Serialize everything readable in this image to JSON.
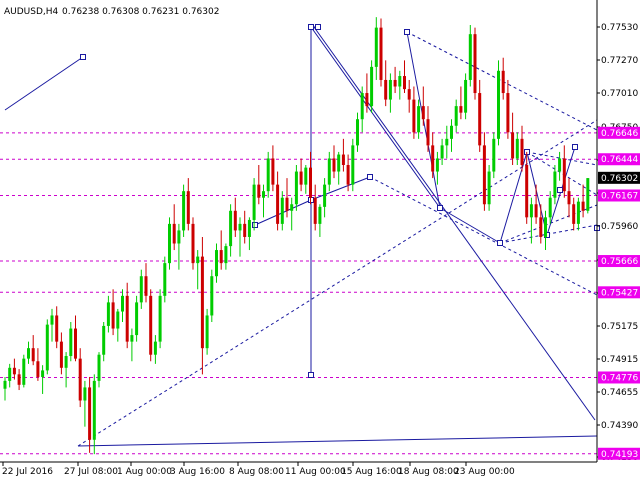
{
  "header": {
    "symbol": "AUDUSD,H4",
    "quotes": "0.76238 0.76308 0.76231 0.76302"
  },
  "colors": {
    "background": "#ffffff",
    "frame": "#000000",
    "bull_candle": "#00cc00",
    "bear_candle": "#cc0000",
    "level_line": "#cc00cc",
    "level_label_bg": "#ee00ee",
    "current_price_bg": "#000000",
    "trendline": "#1a1aa0",
    "channel_dotted": "#1a1aa0",
    "pattern_line": "#1a1aa0"
  },
  "icons": {
    "anchor_marker": "square-anchor-icon"
  },
  "chart_data": {
    "type": "candlestick",
    "timeframe": "H4",
    "y_axis": {
      "ylim": [
        0.7413,
        0.776
      ],
      "ticks": [
        "0.77530",
        "0.77270",
        "0.77010",
        "0.76750",
        "0.76490",
        "0.76225",
        "0.75960",
        "0.75700",
        "0.75435",
        "0.75175",
        "0.74915",
        "0.74655",
        "0.74390",
        "0.74130"
      ]
    },
    "x_axis": {
      "labels": [
        "22 Jul 2016",
        "27 Jul 08:00",
        "1 Aug 00:00",
        "3 Aug 16:00",
        "8 Aug 08:00",
        "11 Aug 00:00",
        "15 Aug 16:00",
        "18 Aug 08:00",
        "23 Aug 00:00"
      ]
    },
    "current_price": "0.76302",
    "levels": [
      {
        "value": 0.76646,
        "label": "0.76646"
      },
      {
        "value": 0.76444,
        "label": "0.76444"
      },
      {
        "value": 0.76167,
        "label": "0.76167"
      },
      {
        "value": 0.75666,
        "label": "0.75666"
      },
      {
        "value": 0.75427,
        "label": "0.75427"
      },
      {
        "value": 0.74776,
        "label": "0.74776"
      },
      {
        "value": 0.74193,
        "label": "0.74193"
      }
    ],
    "candles": [
      [
        0.7469,
        0.7478,
        0.746,
        0.7475
      ],
      [
        0.7475,
        0.7488,
        0.747,
        0.7485
      ],
      [
        0.7485,
        0.7492,
        0.7476,
        0.748
      ],
      [
        0.748,
        0.7484,
        0.7468,
        0.7472
      ],
      [
        0.7472,
        0.7495,
        0.747,
        0.7492
      ],
      [
        0.7492,
        0.7505,
        0.7488,
        0.75
      ],
      [
        0.75,
        0.751,
        0.7487,
        0.749
      ],
      [
        0.749,
        0.75,
        0.7475,
        0.7478
      ],
      [
        0.7478,
        0.7487,
        0.7465,
        0.7483
      ],
      [
        0.7483,
        0.7522,
        0.748,
        0.7518
      ],
      [
        0.7518,
        0.753,
        0.7505,
        0.7525
      ],
      [
        0.7525,
        0.7532,
        0.75,
        0.7505
      ],
      [
        0.7505,
        0.7512,
        0.748,
        0.7485
      ],
      [
        0.7485,
        0.7497,
        0.747,
        0.7494
      ],
      [
        0.7494,
        0.752,
        0.749,
        0.7515
      ],
      [
        0.7515,
        0.7525,
        0.749,
        0.7492
      ],
      [
        0.7492,
        0.75,
        0.7455,
        0.746
      ],
      [
        0.746,
        0.7475,
        0.744,
        0.747
      ],
      [
        0.747,
        0.7478,
        0.742,
        0.743
      ],
      [
        0.743,
        0.748,
        0.7419,
        0.7475
      ],
      [
        0.7475,
        0.7497,
        0.747,
        0.7495
      ],
      [
        0.7495,
        0.752,
        0.749,
        0.7517
      ],
      [
        0.7517,
        0.754,
        0.7512,
        0.7535
      ],
      [
        0.7535,
        0.7545,
        0.751,
        0.7515
      ],
      [
        0.7515,
        0.753,
        0.7505,
        0.7528
      ],
      [
        0.7528,
        0.7545,
        0.752,
        0.754
      ],
      [
        0.754,
        0.755,
        0.75,
        0.7505
      ],
      [
        0.7505,
        0.7515,
        0.749,
        0.751
      ],
      [
        0.751,
        0.754,
        0.7505,
        0.7535
      ],
      [
        0.7535,
        0.756,
        0.753,
        0.7555
      ],
      [
        0.7555,
        0.7565,
        0.7535,
        0.754
      ],
      [
        0.754,
        0.7545,
        0.749,
        0.7495
      ],
      [
        0.7495,
        0.751,
        0.7488,
        0.7505
      ],
      [
        0.7505,
        0.7545,
        0.75,
        0.754
      ],
      [
        0.754,
        0.757,
        0.7535,
        0.7565
      ],
      [
        0.7565,
        0.76,
        0.756,
        0.7595
      ],
      [
        0.7595,
        0.761,
        0.7575,
        0.758
      ],
      [
        0.758,
        0.7595,
        0.756,
        0.759
      ],
      [
        0.759,
        0.7625,
        0.7585,
        0.762
      ],
      [
        0.762,
        0.763,
        0.759,
        0.7595
      ],
      [
        0.7595,
        0.76,
        0.756,
        0.7565
      ],
      [
        0.7565,
        0.7575,
        0.7545,
        0.757
      ],
      [
        0.757,
        0.7585,
        0.748,
        0.75
      ],
      [
        0.75,
        0.753,
        0.7495,
        0.7525
      ],
      [
        0.7525,
        0.756,
        0.752,
        0.7555
      ],
      [
        0.7555,
        0.758,
        0.755,
        0.7575
      ],
      [
        0.7575,
        0.759,
        0.756,
        0.7565
      ],
      [
        0.7565,
        0.758,
        0.756,
        0.7578
      ],
      [
        0.7578,
        0.761,
        0.757,
        0.7605
      ],
      [
        0.7605,
        0.7615,
        0.7585,
        0.759
      ],
      [
        0.759,
        0.76,
        0.757,
        0.7595
      ],
      [
        0.7595,
        0.7605,
        0.758,
        0.7585
      ],
      [
        0.7585,
        0.76,
        0.7575,
        0.7598
      ],
      [
        0.7598,
        0.763,
        0.759,
        0.7625
      ],
      [
        0.7625,
        0.764,
        0.761,
        0.7615
      ],
      [
        0.7615,
        0.7625,
        0.76,
        0.762
      ],
      [
        0.762,
        0.765,
        0.7615,
        0.7645
      ],
      [
        0.7645,
        0.7655,
        0.762,
        0.7625
      ],
      [
        0.7625,
        0.7635,
        0.759,
        0.7595
      ],
      [
        0.7595,
        0.762,
        0.759,
        0.7615
      ],
      [
        0.7615,
        0.763,
        0.76,
        0.7605
      ],
      [
        0.7605,
        0.7615,
        0.759,
        0.761
      ],
      [
        0.761,
        0.764,
        0.7605,
        0.7635
      ],
      [
        0.7635,
        0.7645,
        0.762,
        0.7625
      ],
      [
        0.7625,
        0.764,
        0.7618,
        0.7638
      ],
      [
        0.7638,
        0.765,
        0.761,
        0.7615
      ],
      [
        0.7615,
        0.7625,
        0.759,
        0.7595
      ],
      [
        0.7595,
        0.761,
        0.7585,
        0.7608
      ],
      [
        0.7608,
        0.763,
        0.76,
        0.7625
      ],
      [
        0.7625,
        0.765,
        0.762,
        0.7645
      ],
      [
        0.7645,
        0.7655,
        0.763,
        0.7635
      ],
      [
        0.7635,
        0.765,
        0.7625,
        0.7648
      ],
      [
        0.7648,
        0.766,
        0.7635,
        0.764
      ],
      [
        0.764,
        0.7648,
        0.762,
        0.7625
      ],
      [
        0.7625,
        0.766,
        0.762,
        0.7655
      ],
      [
        0.7655,
        0.768,
        0.765,
        0.7675
      ],
      [
        0.7675,
        0.77,
        0.7665,
        0.7695
      ],
      [
        0.7695,
        0.771,
        0.768,
        0.7685
      ],
      [
        0.7685,
        0.772,
        0.768,
        0.7715
      ],
      [
        0.7715,
        0.7753,
        0.7705,
        0.7745
      ],
      [
        0.7745,
        0.7752,
        0.77,
        0.7705
      ],
      [
        0.7705,
        0.772,
        0.7685,
        0.769
      ],
      [
        0.769,
        0.771,
        0.768,
        0.7705
      ],
      [
        0.7705,
        0.7715,
        0.7695,
        0.77
      ],
      [
        0.77,
        0.7712,
        0.769,
        0.7708
      ],
      [
        0.7708,
        0.772,
        0.7695,
        0.7698
      ],
      [
        0.7698,
        0.7705,
        0.768,
        0.769
      ],
      [
        0.769,
        0.77,
        0.766,
        0.7665
      ],
      [
        0.7665,
        0.769,
        0.766,
        0.7685
      ],
      [
        0.7685,
        0.77,
        0.767,
        0.7675
      ],
      [
        0.7675,
        0.7685,
        0.765,
        0.7655
      ],
      [
        0.7655,
        0.7665,
        0.763,
        0.7635
      ],
      [
        0.7635,
        0.765,
        0.7625,
        0.7645
      ],
      [
        0.7645,
        0.766,
        0.764,
        0.7655
      ],
      [
        0.7655,
        0.767,
        0.7645,
        0.766
      ],
      [
        0.766,
        0.7675,
        0.765,
        0.767
      ],
      [
        0.767,
        0.769,
        0.7665,
        0.7685
      ],
      [
        0.7685,
        0.77,
        0.7675,
        0.768
      ],
      [
        0.768,
        0.771,
        0.7675,
        0.7705
      ],
      [
        0.7705,
        0.7747,
        0.77,
        0.774
      ],
      [
        0.774,
        0.7745,
        0.769,
        0.7695
      ],
      [
        0.7695,
        0.7705,
        0.765,
        0.7655
      ],
      [
        0.7655,
        0.7665,
        0.7605,
        0.761
      ],
      [
        0.761,
        0.764,
        0.7605,
        0.7635
      ],
      [
        0.7635,
        0.7665,
        0.763,
        0.766
      ],
      [
        0.766,
        0.772,
        0.7655,
        0.7712
      ],
      [
        0.7712,
        0.7722,
        0.769,
        0.7695
      ],
      [
        0.7695,
        0.7705,
        0.766,
        0.7665
      ],
      [
        0.7665,
        0.768,
        0.764,
        0.7645
      ],
      [
        0.7645,
        0.7665,
        0.764,
        0.766
      ],
      [
        0.766,
        0.767,
        0.7635,
        0.764
      ],
      [
        0.764,
        0.765,
        0.7595,
        0.76
      ],
      [
        0.76,
        0.7615,
        0.758,
        0.761
      ],
      [
        0.761,
        0.7625,
        0.7595,
        0.76
      ],
      [
        0.76,
        0.761,
        0.758,
        0.7585
      ],
      [
        0.7585,
        0.7605,
        0.7575,
        0.76
      ],
      [
        0.76,
        0.762,
        0.7595,
        0.7615
      ],
      [
        0.7615,
        0.764,
        0.761,
        0.7635
      ],
      [
        0.7635,
        0.765,
        0.7628,
        0.7645
      ],
      [
        0.7645,
        0.7655,
        0.7615,
        0.762
      ],
      [
        0.762,
        0.763,
        0.76,
        0.761
      ],
      [
        0.761,
        0.7615,
        0.759,
        0.7595
      ],
      [
        0.7595,
        0.7615,
        0.759,
        0.7612
      ],
      [
        0.7612,
        0.7625,
        0.76,
        0.7605
      ],
      [
        0.7605,
        0.763,
        0.7603,
        0.763
      ]
    ],
    "title": "",
    "xlabel": "",
    "ylabel": ""
  }
}
